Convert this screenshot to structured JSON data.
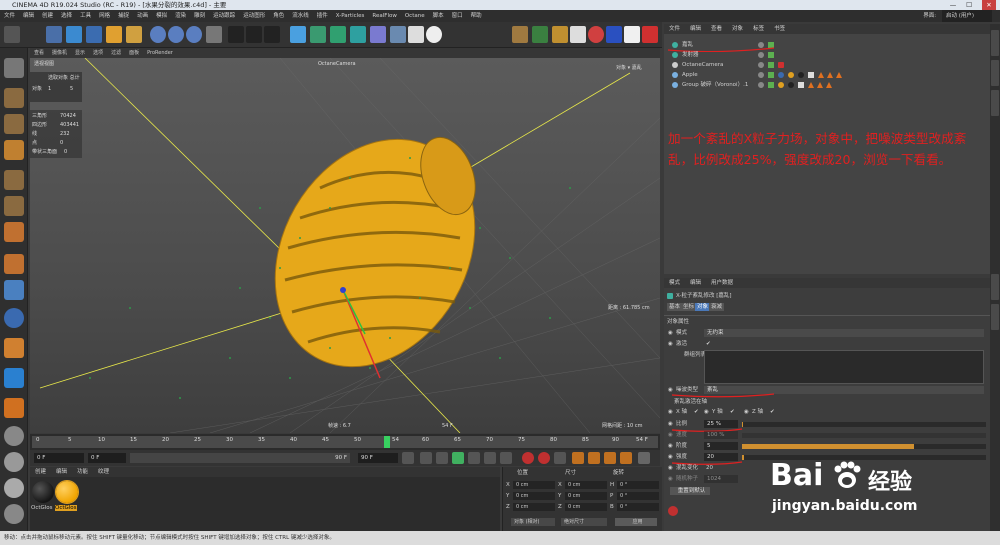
{
  "window": {
    "title": "CINEMA 4D R19.024 Studio (RC - R19) - [水果分裂的效果.c4d] - 主要"
  },
  "menubar": {
    "items": [
      "文件",
      "编辑",
      "创建",
      "选择",
      "工具",
      "网格",
      "捕捉",
      "动画",
      "模拟",
      "渲染",
      "雕刻",
      "运动跟踪",
      "运动图形",
      "角色",
      "流水线",
      "插件",
      "X-Particles",
      "RealFlow",
      "Octane",
      "脚本",
      "窗口",
      "帮助"
    ],
    "layout_label": "界面:",
    "layout_value": "启动 (用户)"
  },
  "viewport": {
    "menu": [
      "查看",
      "摄像机",
      "显示",
      "选项",
      "过滤",
      "面板",
      "ProRender"
    ],
    "view_name": "透视视图",
    "camera_label": "OctaneCamera",
    "top_right": "对象  ▾  嘉乱",
    "hud_select_header": "选取对象 总计",
    "hud_objects_label": "对象",
    "hud_objects_selected": "1",
    "hud_objects_total": "5",
    "stats": [
      {
        "label": "三角形",
        "value": "70424"
      },
      {
        "label": "四边形",
        "value": "403441"
      },
      {
        "label": "线",
        "value": "232"
      },
      {
        "label": "点",
        "value": "0"
      },
      {
        "label": "带状三角面",
        "value": "0"
      }
    ],
    "distance": "距离 : 61.785 cm",
    "fps": "帧速 : 6.7",
    "frame": "54 F",
    "grid": "网格间距 : 10 cm"
  },
  "timeline": {
    "ticks": [
      "0",
      "5",
      "10",
      "15",
      "20",
      "25",
      "30",
      "35",
      "40",
      "45",
      "50",
      "54",
      "60",
      "65",
      "70",
      "75",
      "80",
      "85",
      "90"
    ],
    "current_frame": "54 F"
  },
  "playbar": {
    "start": "0 F",
    "current": "0 F",
    "end_a": "90 F",
    "end_b": "90 F"
  },
  "materials": {
    "menu": [
      "创建",
      "编辑",
      "功能",
      "纹理"
    ],
    "items": [
      {
        "name": "OctGlos",
        "color": "#151515"
      },
      {
        "name": "OctGlos",
        "color": "#f0a400"
      }
    ]
  },
  "coords": {
    "headers": [
      "位置",
      "尺寸",
      "旋转"
    ],
    "rows": [
      {
        "axis": "X",
        "pos": "0 cm",
        "size": "0 cm",
        "rot_label": "H",
        "rot": "0 °"
      },
      {
        "axis": "Y",
        "pos": "0 cm",
        "size": "0 cm",
        "rot_label": "P",
        "rot": "0 °"
      },
      {
        "axis": "Z",
        "pos": "0 cm",
        "size": "0 cm",
        "rot_label": "B",
        "rot": "0 °"
      }
    ],
    "mode": "对象 (相对)",
    "size_mode": "绝对尺寸",
    "apply": "应用"
  },
  "objects": {
    "menu": [
      "文件",
      "编辑",
      "查看",
      "对象",
      "标签",
      "书签"
    ],
    "rows": [
      {
        "name": "嘉乱"
      },
      {
        "name": "发射器"
      },
      {
        "name": "OctaneCamera"
      },
      {
        "name": "Apple"
      },
      {
        "name": "Group 破碎（Voronoi）.1"
      }
    ]
  },
  "annotation": "加一个紊乱的X粒子力场，对象中，把噪波类型改成紊乱，比例改成25%，强度改成20，浏览一下看看。",
  "attributes": {
    "menu": [
      "模式",
      "编辑",
      "用户数据"
    ],
    "object_title": "X-粒子紊乱修改 [嘉乱]",
    "tabs": [
      "基本",
      "坐标",
      "对象",
      "衰减"
    ],
    "section": "对象属性",
    "fields": {
      "mode_label": "模式",
      "mode_value": "无约束",
      "enabled_label": "激活",
      "group_label": "群组列表",
      "noise_label": "噪波类型",
      "noise_value": "紊乱",
      "axes_label": "紊乱激活在轴",
      "axis_x": "X 轴",
      "axis_y": "Y 轴",
      "axis_z": "Z 轴",
      "scale_label": "比例",
      "scale_value": "25 %",
      "speed_label": "速度",
      "speed_value": "100 %",
      "octaves_label": "阶度",
      "octaves_value": "5",
      "strength_label": "强度",
      "strength_value": "20",
      "anim_label": "混乱变化",
      "anim_value": "20",
      "seed_label": "随机种子",
      "seed_value": "1024",
      "reset_label": "重置到默认"
    }
  },
  "status": {
    "text": "移动：点击并拖动鼠标移动元素。按住 SHIFT 键量化移动；节点编辑模式时按住 SHIFT 键增加选择对象；按住 CTRL 键减少选择对象。"
  },
  "watermark": {
    "brand": "Bai",
    "brand2": "经验",
    "url": "jingyan.baidu.com"
  }
}
